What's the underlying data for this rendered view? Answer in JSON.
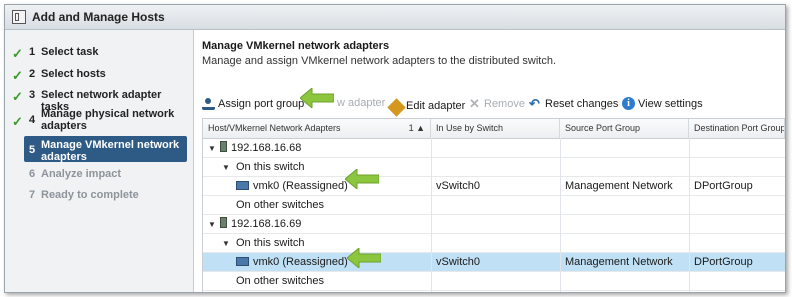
{
  "window": {
    "title": "Add and Manage Hosts"
  },
  "steps": [
    {
      "num": "1",
      "label": "Select task",
      "state": "done"
    },
    {
      "num": "2",
      "label": "Select hosts",
      "state": "done"
    },
    {
      "num": "3",
      "label": "Select network adapter tasks",
      "state": "done"
    },
    {
      "num": "4",
      "label": "Manage physical network adapters",
      "state": "done"
    },
    {
      "num": "5",
      "label": "Manage VMkernel network adapters",
      "state": "active"
    },
    {
      "num": "6",
      "label": "Analyze impact",
      "state": "disabled"
    },
    {
      "num": "7",
      "label": "Ready to complete",
      "state": "disabled"
    }
  ],
  "main": {
    "title": "Manage VMkernel network adapters",
    "subtitle": "Manage and assign VMkernel network adapters to the distributed switch."
  },
  "toolbar": {
    "assign": "Assign port group",
    "new_adapter": "w adapter",
    "edit": "Edit adapter",
    "remove": "Remove",
    "reset": "Reset changes",
    "view": "View settings"
  },
  "grid": {
    "columns": [
      "Host/VMkernel Network Adapters",
      "In Use by Switch",
      "Source Port Group",
      "Destination Port Group"
    ],
    "sort_indicator": "1 ▲",
    "rows": [
      {
        "c0": "192.168.16.68",
        "c1": "",
        "c2": "",
        "c3": ""
      },
      {
        "c0": "On this switch",
        "c1": "",
        "c2": "",
        "c3": ""
      },
      {
        "c0": "vmk0 (Reassigned)",
        "c1": "vSwitch0",
        "c2": "Management Network",
        "c3": "DPortGroup"
      },
      {
        "c0": "On other switches",
        "c1": "",
        "c2": "",
        "c3": ""
      },
      {
        "c0": "192.168.16.69",
        "c1": "",
        "c2": "",
        "c3": ""
      },
      {
        "c0": "On this switch",
        "c1": "",
        "c2": "",
        "c3": ""
      },
      {
        "c0": "vmk0 (Reassigned)",
        "c1": "vSwitch0",
        "c2": "Management Network",
        "c3": "DPortGroup"
      },
      {
        "c0": "On other switches",
        "c1": "",
        "c2": "",
        "c3": ""
      }
    ]
  },
  "colors": {
    "accent": "#2e5a86",
    "selection": "#bfe0f5",
    "check": "#3a9a2c",
    "arrow": "#8cc63f"
  }
}
